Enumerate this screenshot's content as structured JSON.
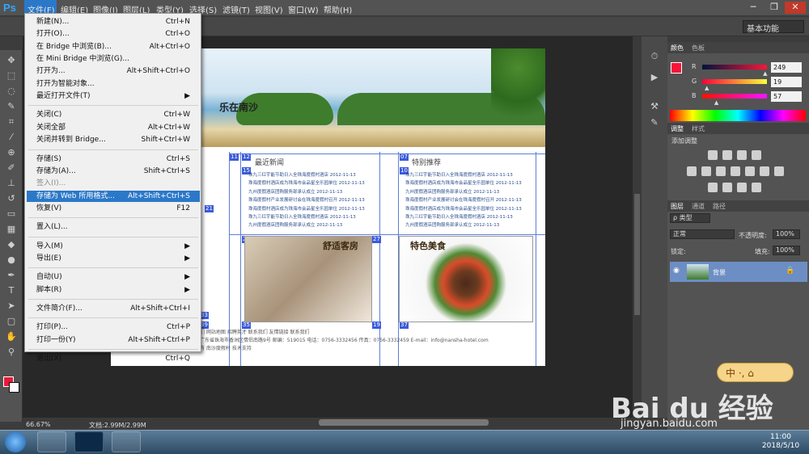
{
  "app": {
    "logo": "Ps"
  },
  "menubar": {
    "items": [
      "文件(F)",
      "编辑(E)",
      "图像(I)",
      "图层(L)",
      "类型(Y)",
      "选择(S)",
      "滤镜(T)",
      "视图(V)",
      "窗口(W)",
      "帮助(H)"
    ]
  },
  "window_buttons": {
    "minimize": "─",
    "restore": "❐",
    "close": "✕"
  },
  "workspace": {
    "label": "基本功能"
  },
  "file_menu": {
    "items": [
      {
        "label": "新建(N)...",
        "shortcut": "Ctrl+N"
      },
      {
        "label": "打开(O)...",
        "shortcut": "Ctrl+O"
      },
      {
        "label": "在 Bridge 中浏览(B)...",
        "shortcut": "Alt+Ctrl+O"
      },
      {
        "label": "在 Mini Bridge 中浏览(G)...",
        "shortcut": ""
      },
      {
        "label": "打开为...",
        "shortcut": "Alt+Shift+Ctrl+O"
      },
      {
        "label": "打开为智能对象...",
        "shortcut": ""
      },
      {
        "label": "最近打开文件(T)",
        "shortcut": "▶"
      },
      {
        "label": "关闭(C)",
        "shortcut": "Ctrl+W"
      },
      {
        "label": "关闭全部",
        "shortcut": "Alt+Ctrl+W"
      },
      {
        "label": "关闭并转到 Bridge...",
        "shortcut": "Shift+Ctrl+W"
      },
      {
        "label": "存储(S)",
        "shortcut": "Ctrl+S"
      },
      {
        "label": "存储为(A)...",
        "shortcut": "Shift+Ctrl+S"
      },
      {
        "label": "签入(I)...",
        "shortcut": ""
      },
      {
        "label": "存储为 Web 所用格式...",
        "shortcut": "Alt+Shift+Ctrl+S"
      },
      {
        "label": "恢复(V)",
        "shortcut": "F12"
      },
      {
        "label": "置入(L)...",
        "shortcut": ""
      },
      {
        "label": "导入(M)",
        "shortcut": "▶"
      },
      {
        "label": "导出(E)",
        "shortcut": "▶"
      },
      {
        "label": "自动(U)",
        "shortcut": "▶"
      },
      {
        "label": "脚本(R)",
        "shortcut": "▶"
      },
      {
        "label": "文件简介(F)...",
        "shortcut": "Alt+Shift+Ctrl+I"
      },
      {
        "label": "打印(P)...",
        "shortcut": "Ctrl+P"
      },
      {
        "label": "打印一份(Y)",
        "shortcut": "Alt+Shift+Ctrl+P"
      },
      {
        "label": "退出(X)",
        "shortcut": "Ctrl+Q"
      }
    ]
  },
  "document": {
    "slogan1": "南沙",
    "slogan2": "乐在南沙",
    "news_title": "最近新闻",
    "recommend_title": "特别推荐",
    "hotel_caption": "舒适客房",
    "food_caption": "特色美食",
    "news_items": [
      "珠九三红宇能节助日入全珠海度假村酒店 2012-11-13",
      "珠海度假村酒店成为珠海市会品星全乐园单位 2012-11-13",
      "九州度假酒店团购服务部承认成立 2012-11-13",
      "珠海度假村产业发展研讨会在珠海度假村召开 2012-11-13",
      "珠海度假村酒店成为珠海市会品星全乐园单位 2012-11-13",
      "珠九三红宇能节助日入全珠海度假村酒店 2012-11-13",
      "九州度假酒店团购服务部承认成立 2012-11-13"
    ],
    "recommend_items": [
      "珠九三红宇能节助日入全珠海度假村酒店 2012-11-13",
      "珠海度假村酒店成为珠海市会品星全乐园单位 2012-11-13",
      "九州度假酒店团购服务部承认成立 2012-11-13",
      "珠海度假村产业发展研讨会在珠海度假村召开 2012-11-13",
      "珠海度假村酒店成为珠海市会品星全乐园单位 2012-11-13",
      "珠九三红宇能节助日入全珠海度假村酒店 2012-11-13",
      "九州度假酒店团购服务部承认成立 2012-11-13"
    ],
    "footer_line1": "关于我们  网站地图  招聘英才  联系我们  友情链接  联系我们",
    "footer_line2": "地址：广东省珠海市香洲区情侣南路9号  邮编：519015  电话：0756-3332456  传真：0756-3332459  E-mail：info@nansha-hotel.com",
    "footer_line3": "版权所有 南沙度假村 技术支持",
    "slices": [
      "11",
      "12",
      "07",
      "15",
      "10",
      "26",
      "29",
      "21",
      "27",
      "33",
      "35",
      "37",
      "39",
      "19"
    ]
  },
  "status": {
    "zoom": "66.67%",
    "doc": "文档:2.99M/2.99M"
  },
  "color_panel": {
    "tabs": [
      "颜色",
      "色板"
    ],
    "r_label": "R",
    "g_label": "G",
    "b_label": "B",
    "r": "249",
    "g": "19",
    "b": "57",
    "r_fill": 0.976,
    "g_fill": 0.075,
    "b_fill": 0.224,
    "color": "#f91339"
  },
  "adjust_panel": {
    "tabs": [
      "调整",
      "样式"
    ],
    "title": "添加调整"
  },
  "layers_panel": {
    "tabs": [
      "图层",
      "通道",
      "路径"
    ],
    "kind": "ρ 类型",
    "blend": "正常",
    "opacity_label": "不透明度:",
    "opacity": "100%",
    "lock_label": "锁定:",
    "fill_label": "填充:",
    "fill": "100%",
    "layer_name": "背景"
  },
  "taskbar": {
    "time": "11:00",
    "date": "2018/5/10"
  },
  "watermark": {
    "brand": "Bai du 经验",
    "url": "jingyan.baidu.com",
    "badge": "中 ·, ⌂"
  }
}
